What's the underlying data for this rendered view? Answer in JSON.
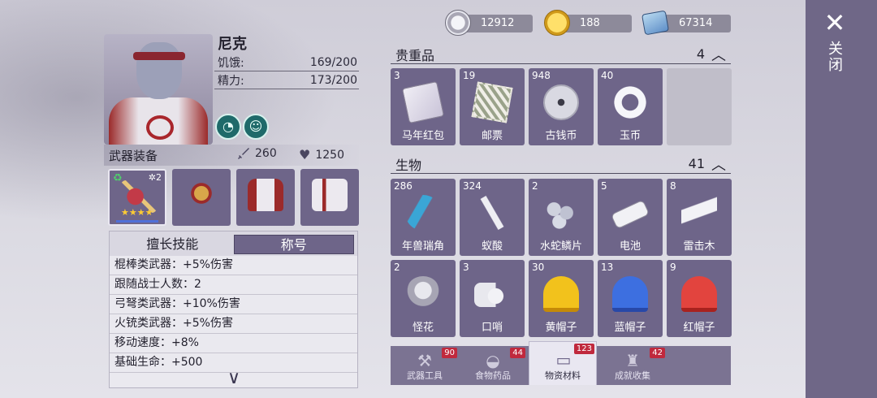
{
  "character": {
    "name": "尼克",
    "stats": [
      {
        "label": "饥饿:",
        "value": "169/200"
      },
      {
        "label": "精力:",
        "value": "173/200"
      }
    ]
  },
  "equipment": {
    "title": "武器装备",
    "attack": "260",
    "defense": "1250",
    "slots": [
      {
        "name": "weapon",
        "badge": "2",
        "stars": "★★★★"
      },
      {
        "name": "accessory"
      },
      {
        "name": "armor"
      },
      {
        "name": "pants"
      }
    ]
  },
  "skills": {
    "tabs": [
      "擅长技能",
      "称号"
    ],
    "active_tab": 1,
    "rows": [
      "棍棒类武器：+5%伤害",
      "跟随战士人数：2",
      "弓弩类武器：+10%伤害",
      "火铳类武器：+5%伤害",
      "移动速度：+8%",
      "基础生命：+500"
    ]
  },
  "currencies": [
    {
      "icon": "silver-coins-icon",
      "value": "12912"
    },
    {
      "icon": "gold-coin-icon",
      "value": "188"
    },
    {
      "icon": "cash-icon",
      "value": "67314"
    }
  ],
  "inventory": {
    "valuables": {
      "title": "贵重品",
      "count": "4",
      "items": [
        {
          "qty": "3",
          "label": "马年红包",
          "icon": "red-envelope-icon"
        },
        {
          "qty": "19",
          "label": "邮票",
          "icon": "stamp-icon"
        },
        {
          "qty": "948",
          "label": "古钱币",
          "icon": "ancient-coin-icon"
        },
        {
          "qty": "40",
          "label": "玉币",
          "icon": "jade-coin-icon"
        }
      ]
    },
    "creatures": {
      "title": "生物",
      "count": "41",
      "items": [
        {
          "qty": "286",
          "label": "年兽瑞角",
          "icon": "horn-icon"
        },
        {
          "qty": "324",
          "label": "蚁酸",
          "icon": "ant-icon"
        },
        {
          "qty": "2",
          "label": "水蛇鳞片",
          "icon": "scale-icon"
        },
        {
          "qty": "5",
          "label": "电池",
          "icon": "battery-icon"
        },
        {
          "qty": "8",
          "label": "雷击木",
          "icon": "lightning-wood-icon"
        },
        {
          "qty": "2",
          "label": "怪花",
          "icon": "strange-flower-icon"
        },
        {
          "qty": "3",
          "label": "口哨",
          "icon": "whistle-icon"
        },
        {
          "qty": "30",
          "label": "黄帽子",
          "icon": "yellow-helmet-icon"
        },
        {
          "qty": "13",
          "label": "蓝帽子",
          "icon": "blue-helmet-icon"
        },
        {
          "qty": "9",
          "label": "红帽子",
          "icon": "red-helmet-icon"
        }
      ]
    }
  },
  "bottom_tabs": [
    {
      "label": "武器工具",
      "badge": "90",
      "icon": "axe-icon"
    },
    {
      "label": "食物药品",
      "badge": "44",
      "icon": "food-icon"
    },
    {
      "label": "物资材料",
      "badge": "123",
      "icon": "materials-icon"
    },
    {
      "label": "成就收集",
      "badge": "42",
      "icon": "trophy-icon"
    }
  ],
  "active_bottom_tab": 2,
  "close": {
    "label": "关闭"
  }
}
